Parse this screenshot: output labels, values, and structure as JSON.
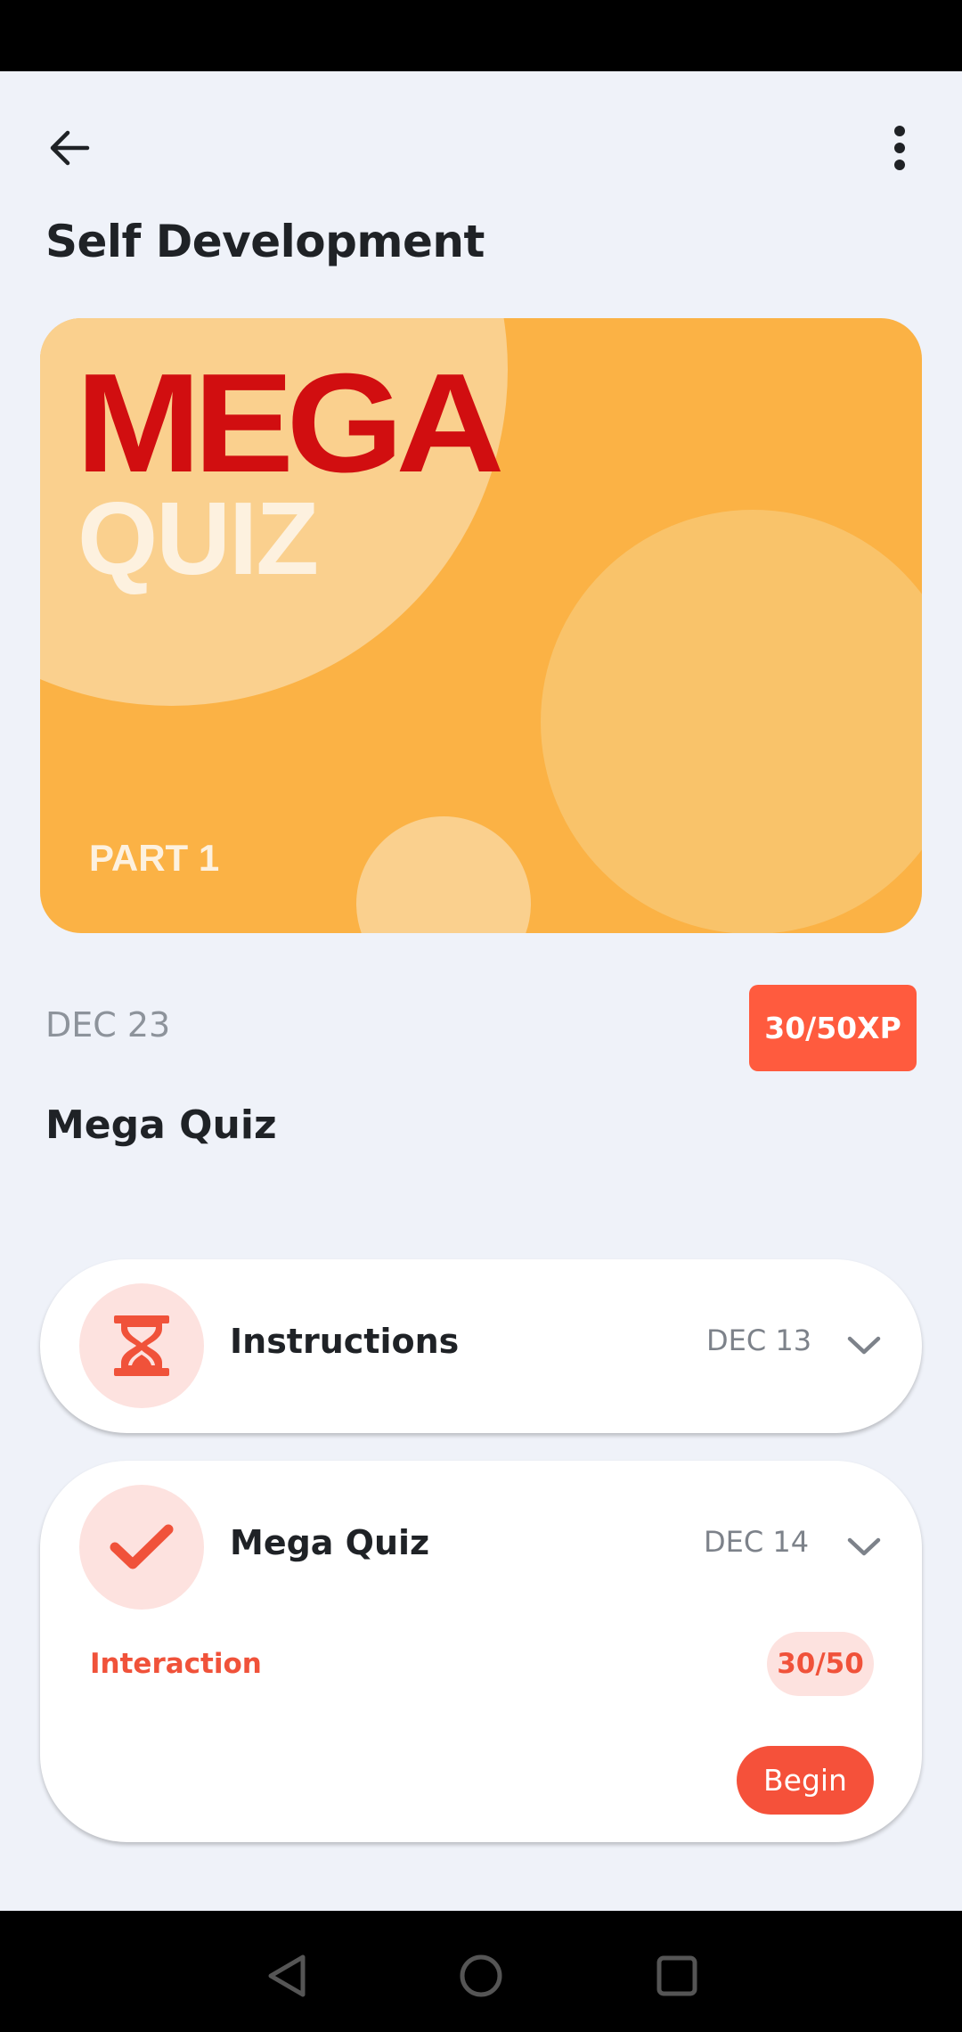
{
  "header": {
    "back_icon": "arrow-left-icon",
    "more_icon": "more-vertical-icon",
    "title": "Self Development"
  },
  "hero": {
    "title": "MEGA",
    "subtitle": "QUIZ",
    "part": "PART 1",
    "colors": {
      "background": "#fbb245",
      "title": "#d10e10",
      "subtitle": "#fdf1df"
    }
  },
  "meta": {
    "date": "DEC 23",
    "xp": "30/50XP"
  },
  "section_title": "Mega Quiz",
  "items": [
    {
      "icon": "hourglass-icon",
      "title": "Instructions",
      "date": "DEC 13",
      "expanded": false
    },
    {
      "icon": "check-icon",
      "title": "Mega Quiz",
      "date": "DEC 14",
      "expanded": true,
      "detail_label": "Interaction",
      "score": "30/50",
      "action_label": "Begin"
    }
  ],
  "colors": {
    "accent": "#f5513a",
    "accent_light": "#fde2df",
    "page_bg": "#eff2f9"
  },
  "system_nav": {
    "back_icon": "nav-back-triangle-icon",
    "home_icon": "nav-home-circle-icon",
    "recents_icon": "nav-recents-square-icon"
  }
}
